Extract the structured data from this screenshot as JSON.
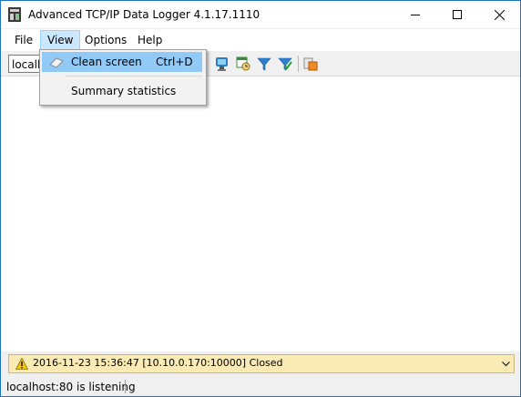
{
  "window": {
    "title": "Advanced TCP/IP Data Logger 4.1.17.1110"
  },
  "menu": {
    "items": [
      {
        "label": "File"
      },
      {
        "label": "View"
      },
      {
        "label": "Options"
      },
      {
        "label": "Help"
      }
    ]
  },
  "view_menu": {
    "clean_screen": {
      "label": "Clean screen",
      "shortcut": "Ctrl+D"
    },
    "summary_statistics": {
      "label": "Summary statistics"
    }
  },
  "toolbar": {
    "host_combo_value": "localhost:80",
    "icons": [
      "monitor-icon",
      "calendar-clock-icon",
      "filter-icon",
      "filter-check-icon",
      "export-icon"
    ]
  },
  "status_log": {
    "message": "2016-11-23 15:36:47 [10.10.0.170:10000] Closed",
    "level_icon": "warning-icon"
  },
  "statusbar": {
    "text": "localhost:80 is listening"
  },
  "colors": {
    "accent_border": "#1e73c8",
    "menu_highlight": "#91c9f7",
    "status_bg": "#faeab3"
  }
}
